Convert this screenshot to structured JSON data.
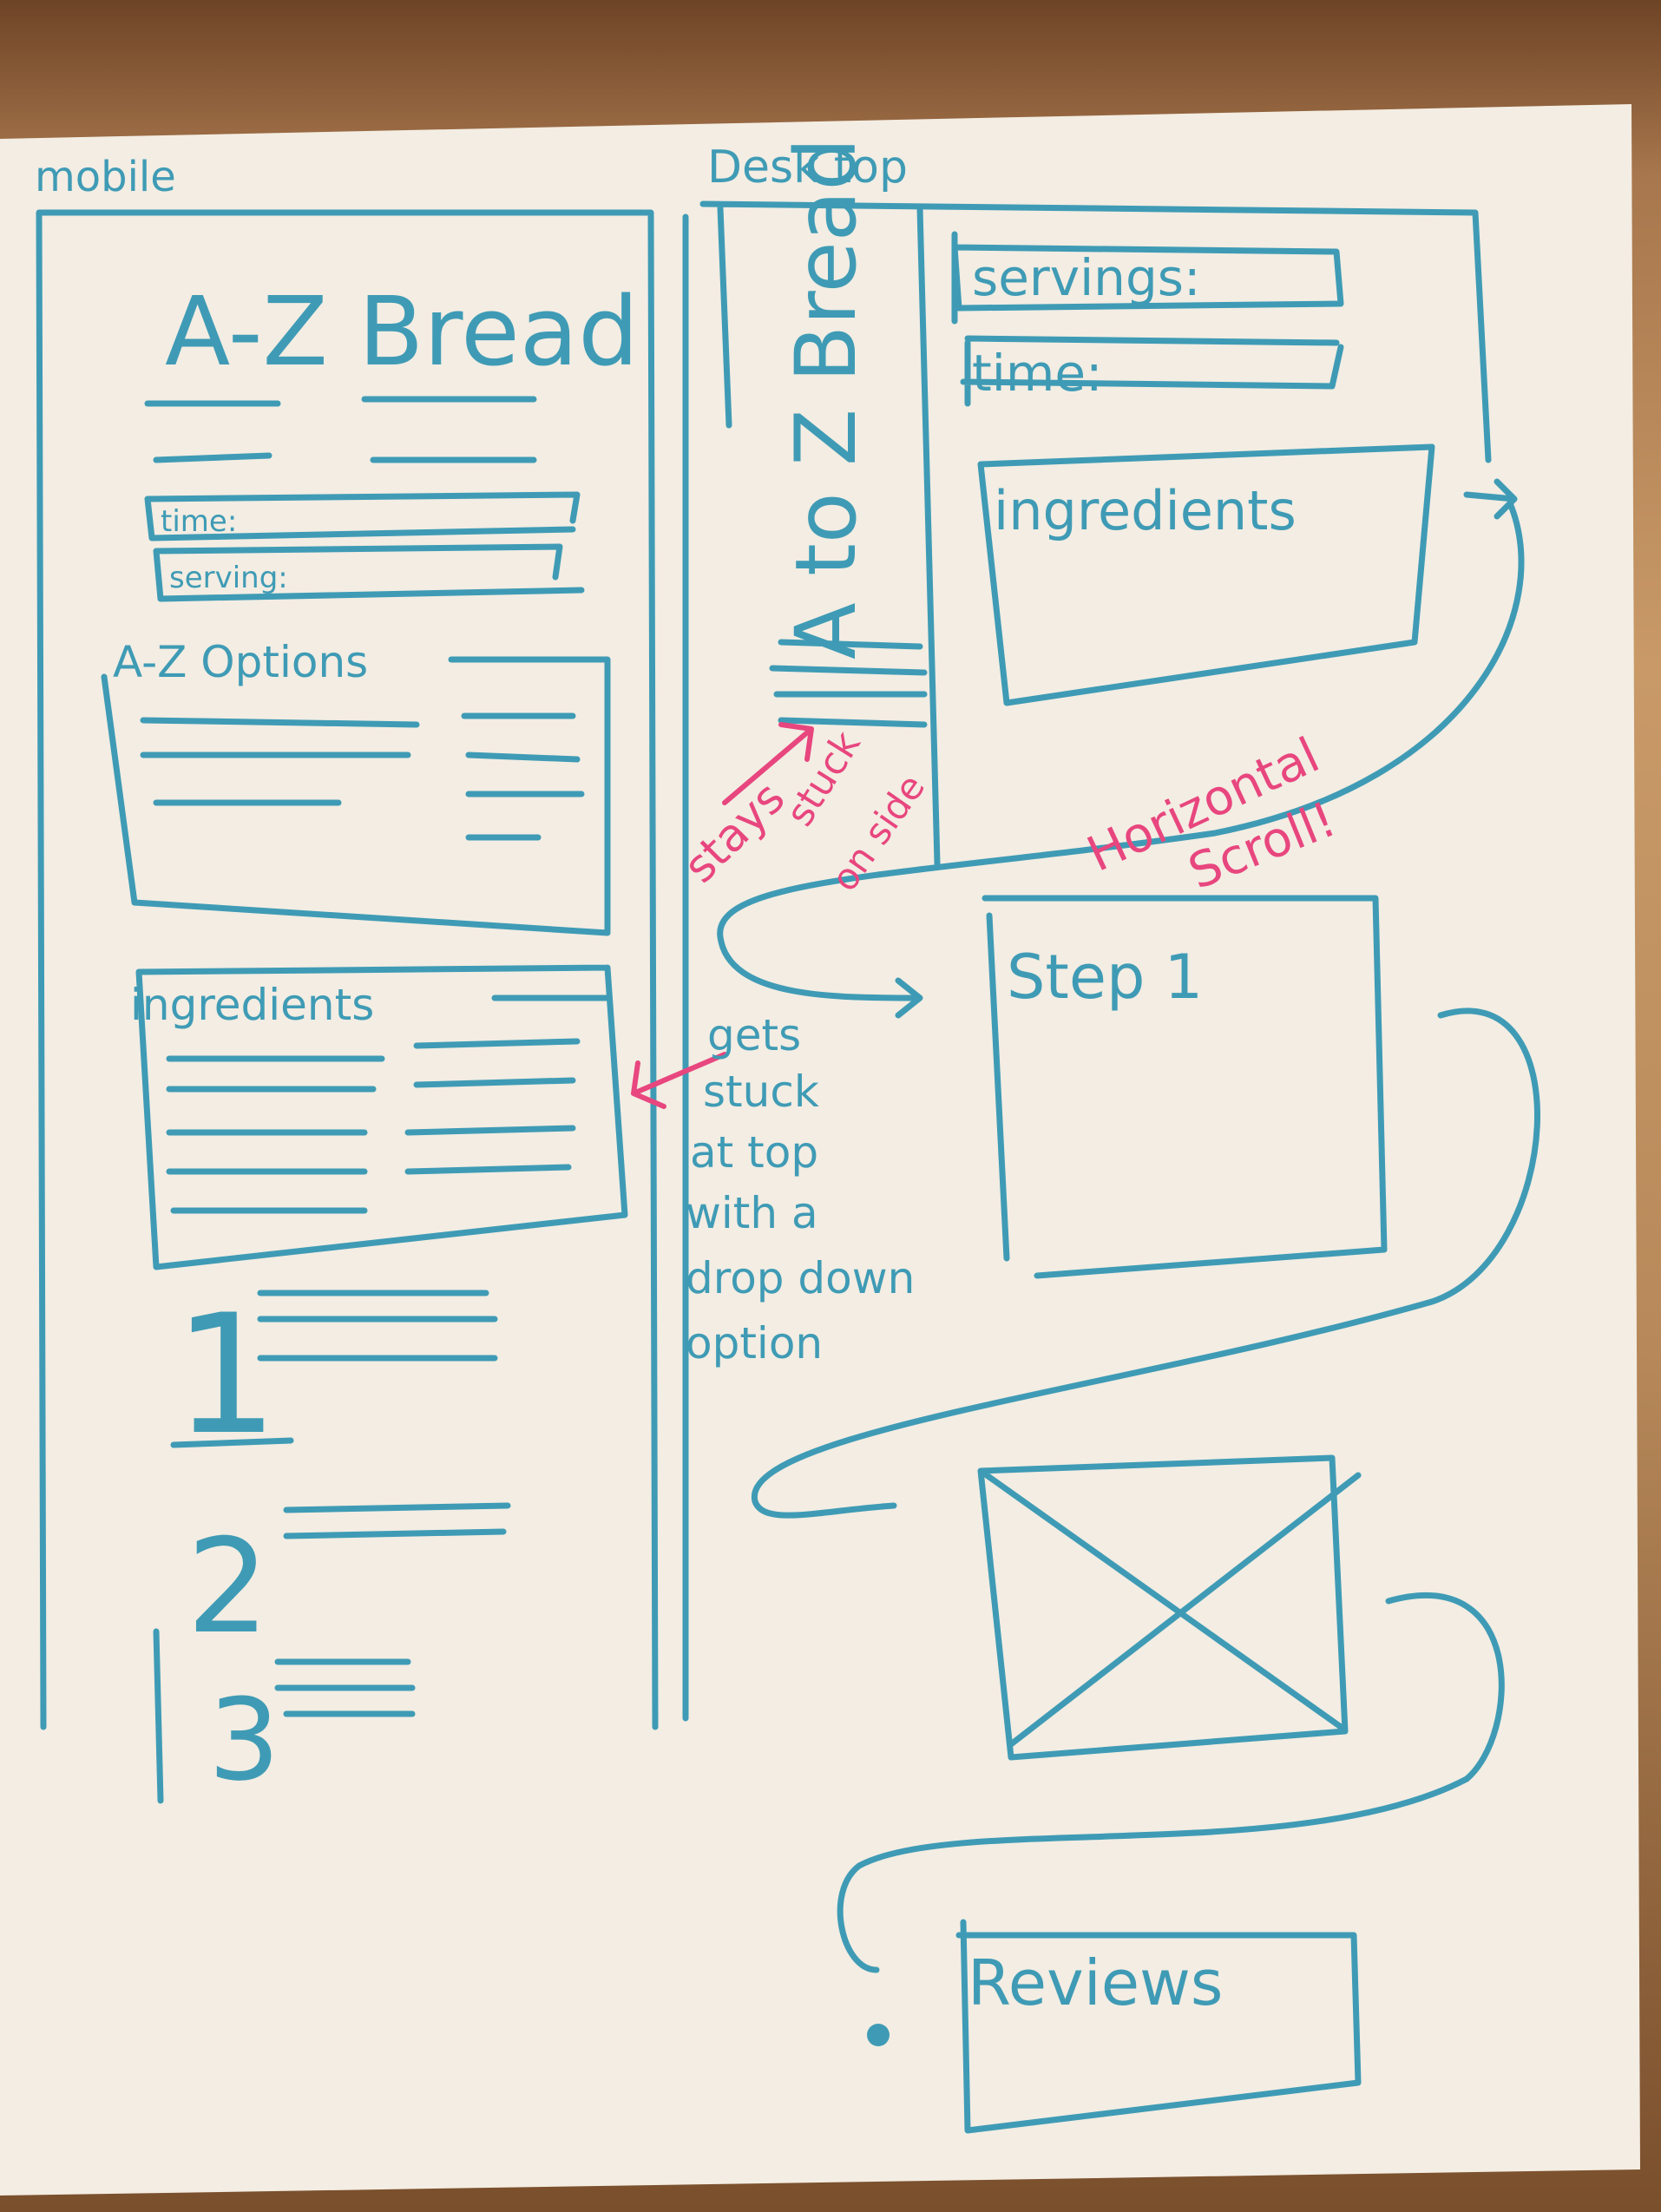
{
  "mobile": {
    "heading": "mobile",
    "title": "A-Z Bread",
    "time_label": "time:",
    "serving_label": "serving:",
    "options_label": "A-Z Options",
    "ingredients_label": "ingredients",
    "steps": [
      "1",
      "2",
      "3"
    ]
  },
  "desktop": {
    "heading": "Desk top",
    "sidebar_title": "A to Z Bread",
    "sidebar_letter": "A",
    "servings_label": "servings:",
    "time_label": "time:",
    "ingredients_label": "ingredients",
    "step_label": "Step 1",
    "reviews_label": "Reviews"
  },
  "notes": {
    "stays_stuck": [
      "stays",
      "stuck",
      "on side"
    ],
    "horizontal_scroll": [
      "Horizontal",
      "Scroll!"
    ],
    "gets_stuck": [
      "gets",
      "stuck",
      "at top",
      "with a",
      "drop down",
      "option"
    ]
  },
  "colors": {
    "marker_blue": "#3f9bb5",
    "marker_pink": "#e8467e",
    "paper": "#f3ede3"
  }
}
